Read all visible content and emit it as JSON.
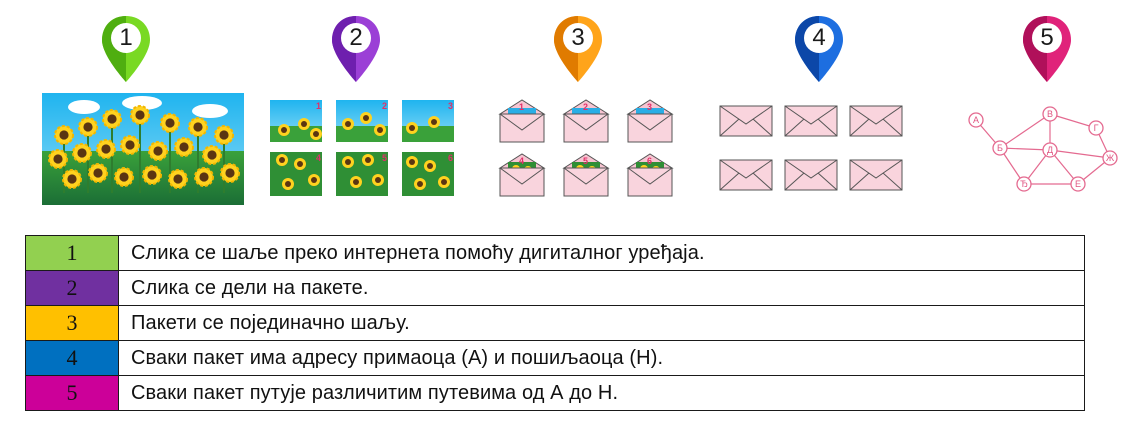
{
  "pins": [
    {
      "label": "1",
      "color": "#79d923",
      "dark": "#4fae10"
    },
    {
      "label": "2",
      "color": "#9b3fd6",
      "dark": "#6e1fae"
    },
    {
      "label": "3",
      "color": "#ffa41a",
      "dark": "#e07b00"
    },
    {
      "label": "4",
      "color": "#1d6ee0",
      "dark": "#0c47a8"
    },
    {
      "label": "5",
      "color": "#e0237a",
      "dark": "#b0105a"
    }
  ],
  "packet_numbers": [
    "1",
    "2",
    "3",
    "4",
    "5",
    "6"
  ],
  "network_nodes": [
    "А",
    "Б",
    "В",
    "Г",
    "Д",
    "Ђ",
    "Е",
    "Ж"
  ],
  "steps": [
    {
      "number": "1",
      "color": "#92d050",
      "text": "Слика се шаље преко интернета помоћу дигиталног уређаја."
    },
    {
      "number": "2",
      "color": "#7030a0",
      "text": "Слика се дели на пакете."
    },
    {
      "number": "3",
      "color": "#ffc000",
      "text": "Пакети се појединачно шаљу."
    },
    {
      "number": "4",
      "color": "#0070c0",
      "text": "Сваки пакет има адресу примаоца (А) и пошиљаоца (Н)."
    },
    {
      "number": "5",
      "color": "#cc0099",
      "text": "Сваки пакет путује различитим путевима од А до Н."
    }
  ]
}
